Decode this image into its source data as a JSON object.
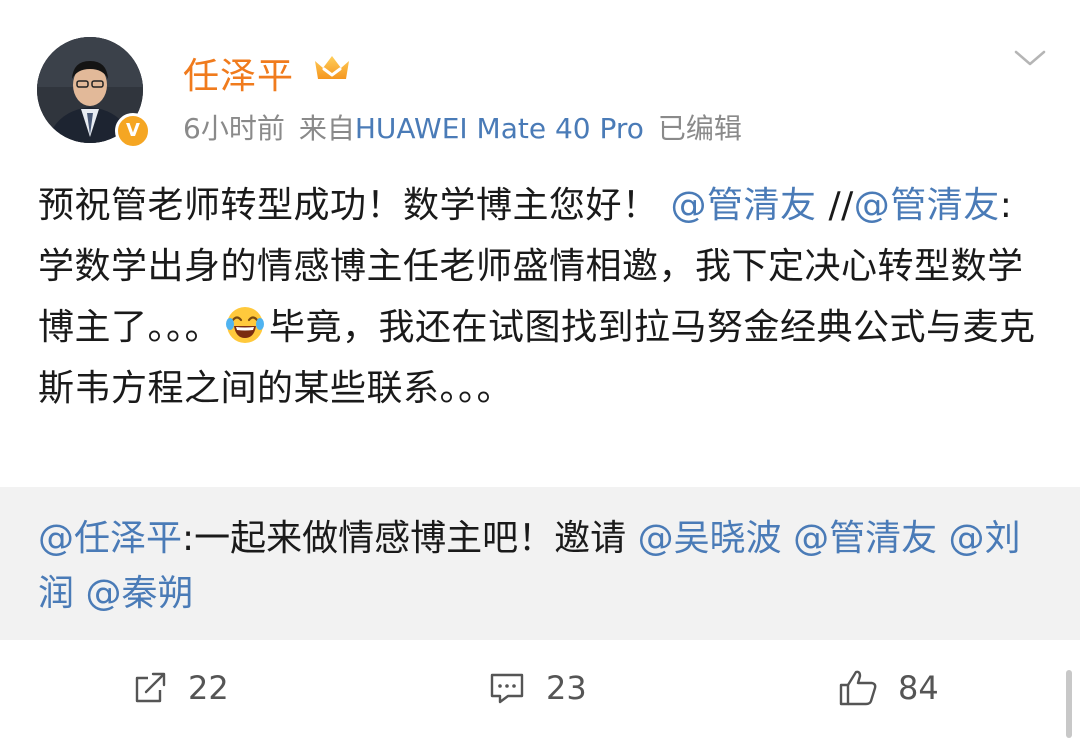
{
  "post": {
    "author": "任泽平",
    "time": "6小时前",
    "source_prefix": "来自",
    "device": "HUAWEI Mate 40 Pro",
    "edited": "已编辑",
    "badge": "V",
    "body": {
      "part1": "预祝管老师转型成功！数学博主您好！",
      "mention1": "@管清友",
      "sep": "//",
      "mention2": "@管清友",
      "part2": ":学数学出身的情感博主任老师盛情相邀，我下定决心转型数学博主了。。。",
      "part3": "毕竟，我还在试图找到拉马努金经典公式与麦克斯韦方程之间的某些联系。。。"
    }
  },
  "repost": {
    "mention_author": "@任泽平",
    "text": ":一起来做情感博主吧！邀请",
    "mentions": [
      "@吴晓波",
      "@管清友",
      "@刘润",
      "@秦朔"
    ]
  },
  "actions": {
    "share_count": "22",
    "comment_count": "23",
    "like_count": "84"
  },
  "colors": {
    "username": "#f07b1d",
    "link": "#4a7bb7",
    "meta": "#8a8a8a",
    "repost_bg": "#f2f2f2"
  },
  "icons": [
    "crown-icon",
    "chevron-down-icon",
    "laugh-emoji-icon",
    "share-icon",
    "comment-icon",
    "like-icon"
  ]
}
